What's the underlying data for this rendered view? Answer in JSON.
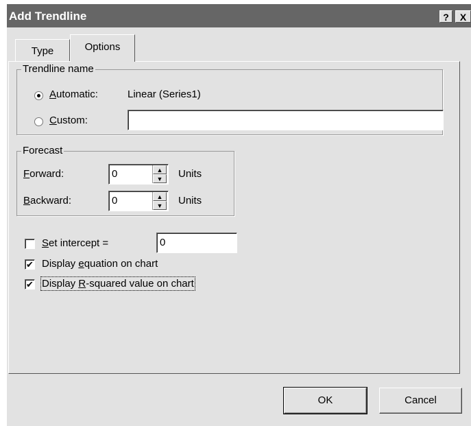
{
  "window": {
    "title": "Add Trendline",
    "help_label": "?",
    "close_label": "X"
  },
  "tabs": [
    {
      "label": "Type",
      "active": false
    },
    {
      "label": "Options",
      "active": true
    }
  ],
  "trendline_name": {
    "legend": "Trendline name",
    "automatic_label_hotkey": "A",
    "automatic_label_rest": "utomatic:",
    "automatic_value": "Linear (Series1)",
    "custom_label_hotkey": "C",
    "custom_label_rest": "ustom:",
    "custom_value": "",
    "selected": "automatic"
  },
  "forecast": {
    "legend": "Forecast",
    "forward_label_hotkey": "F",
    "forward_label_rest": "orward:",
    "forward_value": "0",
    "backward_label_hotkey": "B",
    "backward_label_rest": "ackward:",
    "backward_value": "0",
    "units_label": "Units"
  },
  "options": {
    "set_intercept_hotkey": "S",
    "set_intercept_rest": "et intercept =",
    "set_intercept_checked": false,
    "intercept_value": "0",
    "display_equation_pre": "Display ",
    "display_equation_hotkey": "e",
    "display_equation_rest": "quation on chart",
    "display_equation_checked": true,
    "display_r_pre": "Display ",
    "display_r_hotkey": "R",
    "display_r_rest": "-squared value on chart",
    "display_r_checked": true
  },
  "buttons": {
    "ok": "OK",
    "cancel": "Cancel"
  }
}
